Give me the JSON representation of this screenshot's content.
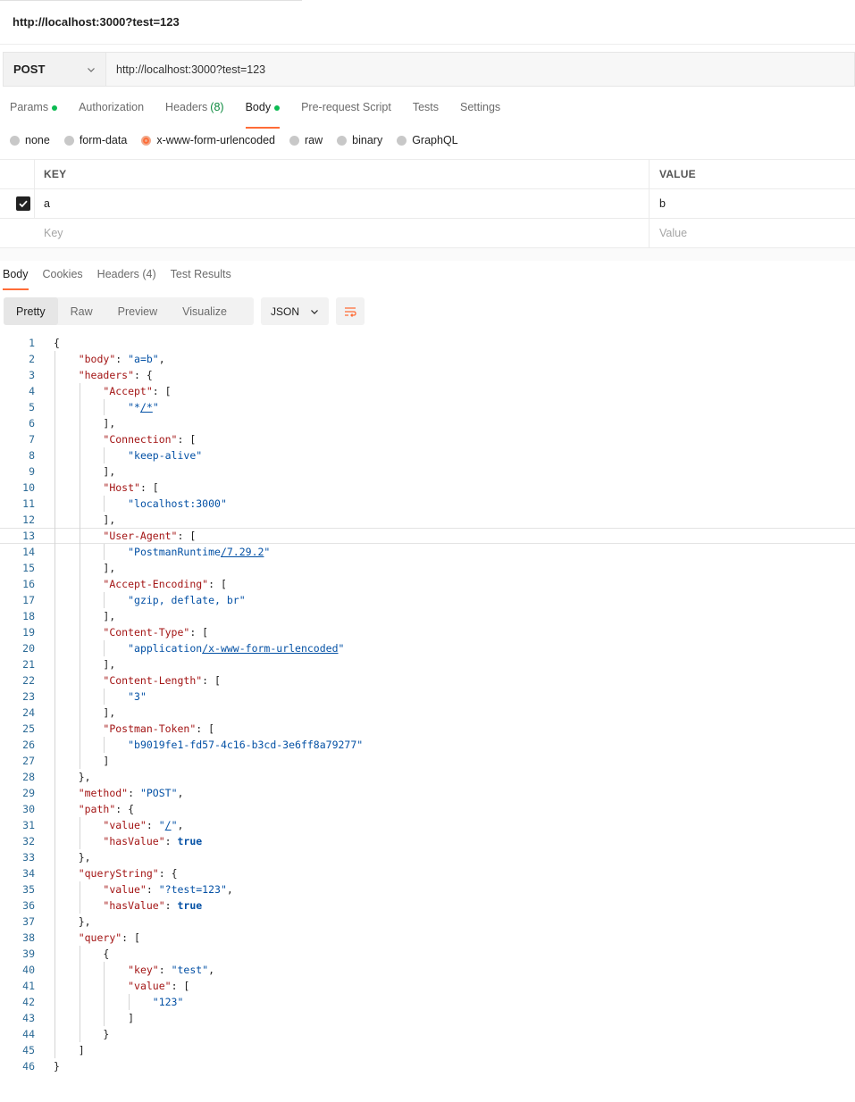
{
  "window": {
    "title": "http://localhost:3000?test=123"
  },
  "request": {
    "method": "POST",
    "url": "http://localhost:3000?test=123",
    "tabs": [
      {
        "label": "Params",
        "dot": true
      },
      {
        "label": "Authorization"
      },
      {
        "label": "Headers",
        "count": "(8)"
      },
      {
        "label": "Body",
        "dot": true,
        "active": true
      },
      {
        "label": "Pre-request Script"
      },
      {
        "label": "Tests"
      },
      {
        "label": "Settings"
      }
    ],
    "body_types": [
      "none",
      "form-data",
      "x-www-form-urlencoded",
      "raw",
      "binary",
      "GraphQL"
    ],
    "selected_body_type": "x-www-form-urlencoded",
    "kv_table": {
      "key_header": "KEY",
      "value_header": "VALUE",
      "rows": [
        {
          "key": "a",
          "value": "b",
          "checked": true
        }
      ],
      "key_placeholder": "Key",
      "value_placeholder": "Value"
    }
  },
  "response": {
    "tabs": [
      {
        "label": "Body",
        "active": true
      },
      {
        "label": "Cookies"
      },
      {
        "label": "Headers",
        "count": "(4)"
      },
      {
        "label": "Test Results"
      }
    ],
    "views": [
      "Pretty",
      "Raw",
      "Preview",
      "Visualize"
    ],
    "active_view": "Pretty",
    "format": "JSON",
    "code_lines": [
      "{",
      "    \"body\": \"a=b\",",
      "    \"headers\": {",
      "        \"Accept\": [",
      "            \"*/*\"",
      "        ],",
      "        \"Connection\": [",
      "            \"keep-alive\"",
      "        ],",
      "        \"Host\": [",
      "            \"localhost:3000\"",
      "        ],",
      "        \"User-Agent\": [",
      "            \"PostmanRuntime/7.29.2\"",
      "        ],",
      "        \"Accept-Encoding\": [",
      "            \"gzip, deflate, br\"",
      "        ],",
      "        \"Content-Type\": [",
      "            \"application/x-www-form-urlencoded\"",
      "        ],",
      "        \"Content-Length\": [",
      "            \"3\"",
      "        ],",
      "        \"Postman-Token\": [",
      "            \"b9019fe1-fd57-4c16-b3cd-3e6ff8a79277\"",
      "        ]",
      "    },",
      "    \"method\": \"POST\",",
      "    \"path\": {",
      "        \"value\": \"/\",",
      "        \"hasValue\": true",
      "    },",
      "    \"queryString\": {",
      "        \"value\": \"?test=123\",",
      "        \"hasValue\": true",
      "    },",
      "    \"query\": [",
      "        {",
      "            \"key\": \"test\",",
      "            \"value\": [",
      "                \"123\"",
      "            ]",
      "        }",
      "    ]",
      "}"
    ]
  },
  "colors": {
    "accent": "#ff6c37",
    "dot_green": "#0cbb52",
    "json_key": "#a31515",
    "json_value": "#0451a5"
  },
  "icons": [
    "chevron-down-icon",
    "checkbox-checked-icon",
    "wrap-lines-icon"
  ]
}
